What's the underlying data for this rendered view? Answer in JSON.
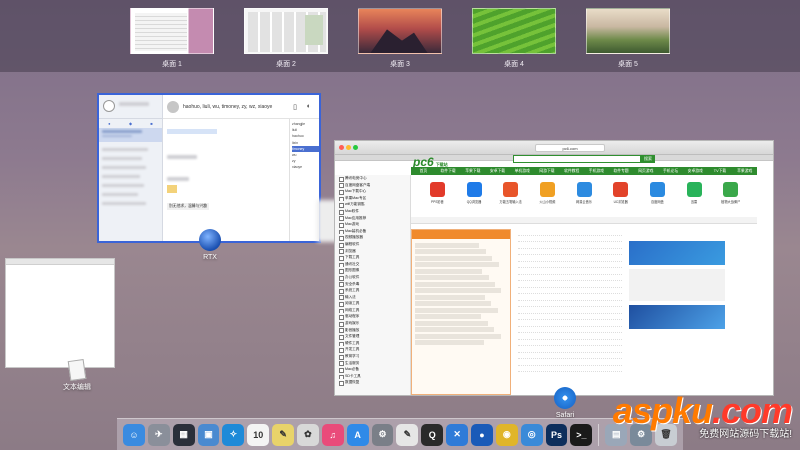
{
  "spaces": [
    {
      "label": "桌面 1"
    },
    {
      "label": "桌面 2"
    },
    {
      "label": "桌面 3"
    },
    {
      "label": "桌面 4"
    },
    {
      "label": "桌面 5"
    }
  ],
  "rtx": {
    "app_label": "RTX",
    "chat_title": "haohuo, liuli, wu, timoney, zy, wz, xiaoye",
    "members": [
      "zhangjie",
      "liuli",
      "haohuo",
      "lixin",
      "timoney",
      "wu",
      "zy",
      "xiaoye"
    ],
    "bubble_text": "别无他求，温馨与兴趣"
  },
  "textedit": {
    "app_label": "文本编辑"
  },
  "safari": {
    "app_label": "Safari",
    "url": "pc6.com",
    "logo": "pc6",
    "logo_sub": "下载站",
    "search_button": "搜索",
    "nav_items": [
      "首页",
      "软件下载",
      "苹果下载",
      "安卓下载",
      "单机游戏",
      "网游下载",
      "软件教程",
      "手机游戏",
      "软件专题",
      "网页游戏",
      "手机论坛",
      "安卓游戏",
      "TV下载",
      "苹果游戏"
    ],
    "apps": [
      {
        "name": "PPS影音",
        "color": "#e23a2a"
      },
      {
        "name": "QQ浏览器",
        "color": "#1f7be8"
      },
      {
        "name": "万能五笔输入法",
        "color": "#e8552a"
      },
      {
        "name": "火山小视频",
        "color": "#f0a023"
      },
      {
        "name": "网易云音乐",
        "color": "#2d8be0"
      },
      {
        "name": "UC浏览器",
        "color": "#e2432a"
      },
      {
        "name": "百度网盘",
        "color": "#2a8ae0"
      },
      {
        "name": "迅雷",
        "color": "#29b35a"
      },
      {
        "name": "植物大战僵尸",
        "color": "#3aa84a"
      }
    ],
    "sidebar_items": [
      "腾讯电竞中心",
      "百度网盘客户端",
      "Mac下载中心",
      "苹果Mac专区",
      "wifi万能钥匙",
      "Mac软件",
      "Mac应用推荐",
      "Mac游戏",
      "Mac装机必备",
      "视频播放器",
      "编程软件",
      "浏览器",
      "下载工具",
      "通讯社交",
      "图形图像",
      "办公软件",
      "安全杀毒",
      "系统工具",
      "输入法",
      "阅读工具",
      "网络工具",
      "驱动程序",
      "游戏娱乐",
      "影音播放",
      "文件管理",
      "硬件工具",
      "开发工具",
      "教育学习",
      "生活服务",
      "Mac必备",
      "SD卡工具",
      "数据恢复"
    ]
  },
  "dock_apps": [
    {
      "name": "finder-icon",
      "glyph": "☺",
      "color": "#3a8be0"
    },
    {
      "name": "launchpad-icon",
      "glyph": "✈",
      "color": "#8a8f9a"
    },
    {
      "name": "mission-control-icon",
      "glyph": "▦",
      "color": "#2b2f3a"
    },
    {
      "name": "preview-icon",
      "glyph": "▣",
      "color": "#4a8ad0"
    },
    {
      "name": "safari-icon",
      "glyph": "✧",
      "color": "#1e8ad8"
    },
    {
      "name": "calendar-icon",
      "glyph": "10",
      "color": "#f4f4f4"
    },
    {
      "name": "notes-icon",
      "glyph": "✎",
      "color": "#e8d36a"
    },
    {
      "name": "photos-icon",
      "glyph": "✿",
      "color": "#d8d8d8"
    },
    {
      "name": "itunes-icon",
      "glyph": "♫",
      "color": "#e94b7a"
    },
    {
      "name": "app-store-icon",
      "glyph": "A",
      "color": "#2f8ae8"
    },
    {
      "name": "system-prefs-icon",
      "glyph": "⚙",
      "color": "#7a7f88"
    },
    {
      "name": "textedit-icon",
      "glyph": "✎",
      "color": "#e6e6e6"
    },
    {
      "name": "quicktime-icon",
      "glyph": "Q",
      "color": "#2a2a2a"
    },
    {
      "name": "xcode-icon",
      "glyph": "✕",
      "color": "#2f7bd8"
    },
    {
      "name": "rtx-icon",
      "glyph": "●",
      "color": "#1a5ab8"
    },
    {
      "name": "chrome-icon",
      "glyph": "◉",
      "color": "#e0b52a"
    },
    {
      "name": "web-icon",
      "glyph": "◎",
      "color": "#3a8ad8"
    },
    {
      "name": "photoshop-icon",
      "glyph": "Ps",
      "color": "#0d2e5c"
    },
    {
      "name": "terminal-icon",
      "glyph": ">_",
      "color": "#1a1a1a"
    },
    {
      "name": "downloads-icon",
      "glyph": "▤",
      "color": "#9aa7b8"
    },
    {
      "name": "settings-folder-icon",
      "glyph": "⚙",
      "color": "#7a8a9a"
    },
    {
      "name": "trash-icon",
      "glyph": "🗑",
      "color": "#c8cdd3"
    }
  ],
  "watermark": {
    "brand": "aspku",
    "tld": ".com",
    "tagline": "免费网站源码下载站!"
  }
}
